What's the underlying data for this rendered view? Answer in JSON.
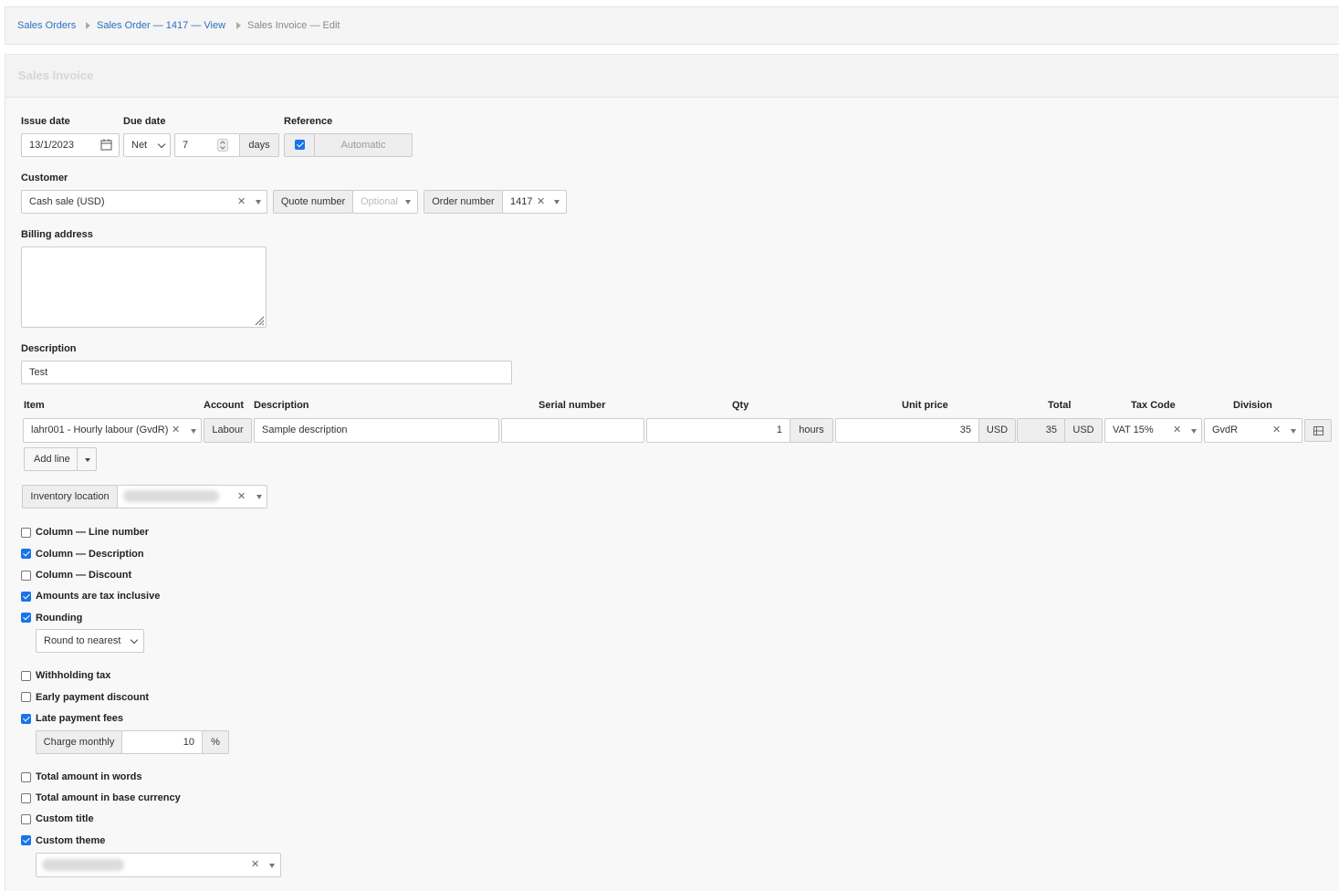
{
  "breadcrumb": [
    "Sales Orders",
    "Sales Order — 1417 — View",
    "Sales Invoice — Edit"
  ],
  "form": {
    "title": "Sales Invoice",
    "issue_date": {
      "label": "Issue date",
      "value": "13/1/2023"
    },
    "due_date": {
      "label": "Due date",
      "type": "Net",
      "value": "7",
      "unit": "days"
    },
    "reference": {
      "label": "Reference",
      "checked": true,
      "placeholder": "Automatic"
    },
    "customer": {
      "label": "Customer",
      "value": "Cash sale (USD)"
    },
    "quote_number": {
      "label": "Quote number",
      "placeholder": "Optional"
    },
    "order_number": {
      "label": "Order number",
      "value": "1417"
    },
    "billing_address": {
      "label": "Billing address",
      "value": ""
    },
    "description": {
      "label": "Description",
      "value": "Test"
    }
  },
  "lines": {
    "headers": {
      "item": "Item",
      "account": "Account",
      "description": "Description",
      "serial": "Serial number",
      "qty": "Qty",
      "unit_price": "Unit price",
      "total": "Total",
      "tax_code": "Tax Code",
      "division": "Division"
    },
    "rows": [
      {
        "item": "lahr001 - Hourly labour (GvdR)",
        "account": "Labour",
        "description": "Sample description",
        "serial": "",
        "qty": "1",
        "qty_unit": "hours",
        "unit_price": "35",
        "currency": "USD",
        "total": "35",
        "total_currency": "USD",
        "tax_code": "VAT 15%",
        "division": "GvdR"
      }
    ],
    "add_line": "Add line"
  },
  "inventory_location": {
    "label": "Inventory location"
  },
  "options": {
    "col_line_number": "Column — Line number",
    "col_description": "Column — Description",
    "col_discount": "Column — Discount",
    "tax_inclusive": "Amounts are tax inclusive",
    "rounding": "Rounding",
    "rounding_value": "Round to nearest",
    "withholding_tax": "Withholding tax",
    "early_payment": "Early payment discount",
    "late_fees": "Late payment fees",
    "late_fee_label": "Charge monthly",
    "late_fee_value": "10",
    "late_fee_unit": "%",
    "total_words": "Total amount in words",
    "total_base": "Total amount in base currency",
    "custom_title": "Custom title",
    "custom_theme": "Custom theme"
  },
  "checked": {
    "col_line_number": false,
    "col_description": true,
    "col_discount": false,
    "tax_inclusive": true,
    "rounding": true,
    "withholding_tax": false,
    "early_payment": false,
    "late_fees": true,
    "total_words": false,
    "total_base": false,
    "custom_title": false,
    "custom_theme": true
  },
  "colors": {
    "link": "#2a6fc0",
    "checkbox": "#1a73e8"
  },
  "icons": [
    "calendar-icon",
    "chevron-down-icon",
    "clear-icon",
    "spinner-icon",
    "resize-handle-icon",
    "row-menu-icon"
  ]
}
